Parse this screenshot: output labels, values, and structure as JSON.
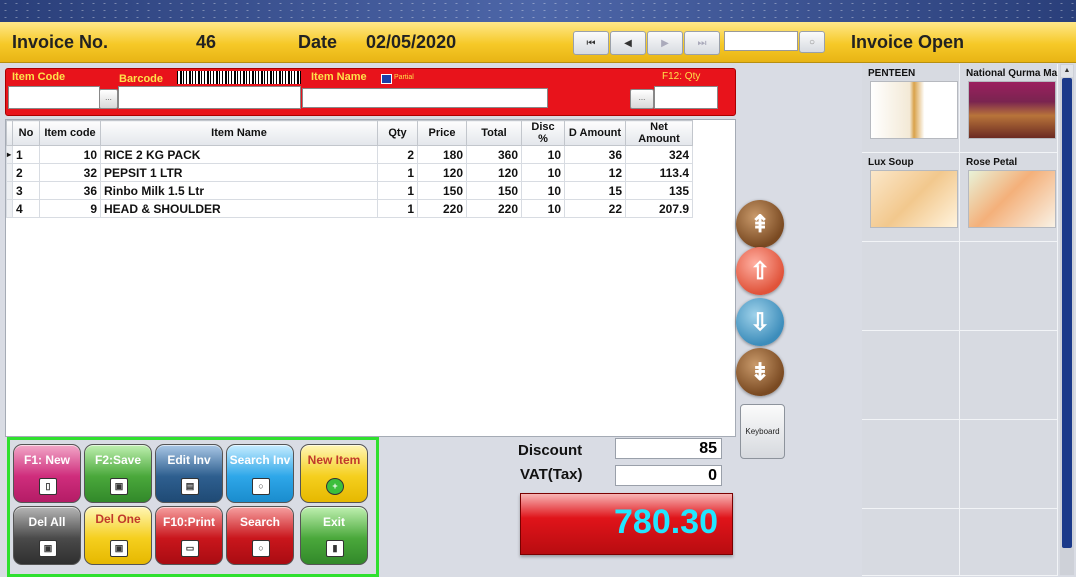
{
  "header": {
    "invoice_label": "Invoice No.",
    "invoice_no": "46",
    "date_label": "Date",
    "date": "02/05/2020",
    "status": "Invoice Open",
    "nav": {
      "first": "◀︎",
      "prev": "◀",
      "next": "▶",
      "last": "▶︎"
    }
  },
  "entry": {
    "item_code_label": "Item Code",
    "barcode_label": "Barcode",
    "item_name_label": "Item Name",
    "partial_label": "Partial",
    "qty_label": "F12: Qty",
    "dots": "..."
  },
  "grid": {
    "columns": [
      "No",
      "Item code",
      "Item Name",
      "Qty",
      "Price",
      "Total",
      "Disc %",
      "D Amount",
      "Net Amount"
    ],
    "rows": [
      {
        "no": "1",
        "code": "10",
        "name": "RICE 2 KG PACK",
        "qty": "2",
        "price": "180",
        "total": "360",
        "disc": "10",
        "damount": "36",
        "net": "324"
      },
      {
        "no": "2",
        "code": "32",
        "name": "PEPSIT 1 LTR",
        "qty": "1",
        "price": "120",
        "total": "120",
        "disc": "10",
        "damount": "12",
        "net": "113.4"
      },
      {
        "no": "3",
        "code": "36",
        "name": "Rinbo Milk 1.5 Ltr",
        "qty": "1",
        "price": "150",
        "total": "150",
        "disc": "10",
        "damount": "15",
        "net": "135"
      },
      {
        "no": "4",
        "code": "9",
        "name": "HEAD & SHOULDER",
        "qty": "1",
        "price": "220",
        "total": "220",
        "disc": "10",
        "damount": "22",
        "net": "207.9"
      }
    ]
  },
  "side": {
    "keyboard_label": "Keyboard"
  },
  "products": [
    {
      "name": "PENTEEN"
    },
    {
      "name": "National Qurma Ma"
    },
    {
      "name": "Lux Soup"
    },
    {
      "name": "Rose Petal"
    }
  ],
  "buttons": {
    "new": "F1: New",
    "save": "F2:Save",
    "edit_inv": "Edit Inv",
    "search_inv": "Search Inv",
    "new_item": "New Item",
    "del_all": "Del All",
    "del_one": "Del One",
    "print": "F10:Print",
    "search": "Search",
    "exit": "Exit"
  },
  "totals": {
    "discount_label": "Discount",
    "discount": "85",
    "vat_label": "VAT(Tax)",
    "vat": "0",
    "grand_total": "780.30"
  },
  "colors": {
    "accent_red": "#e8131b",
    "grand_text": "#22e6ff",
    "header_yellow": "#f6c928",
    "panel_green": "#2fe02f"
  }
}
